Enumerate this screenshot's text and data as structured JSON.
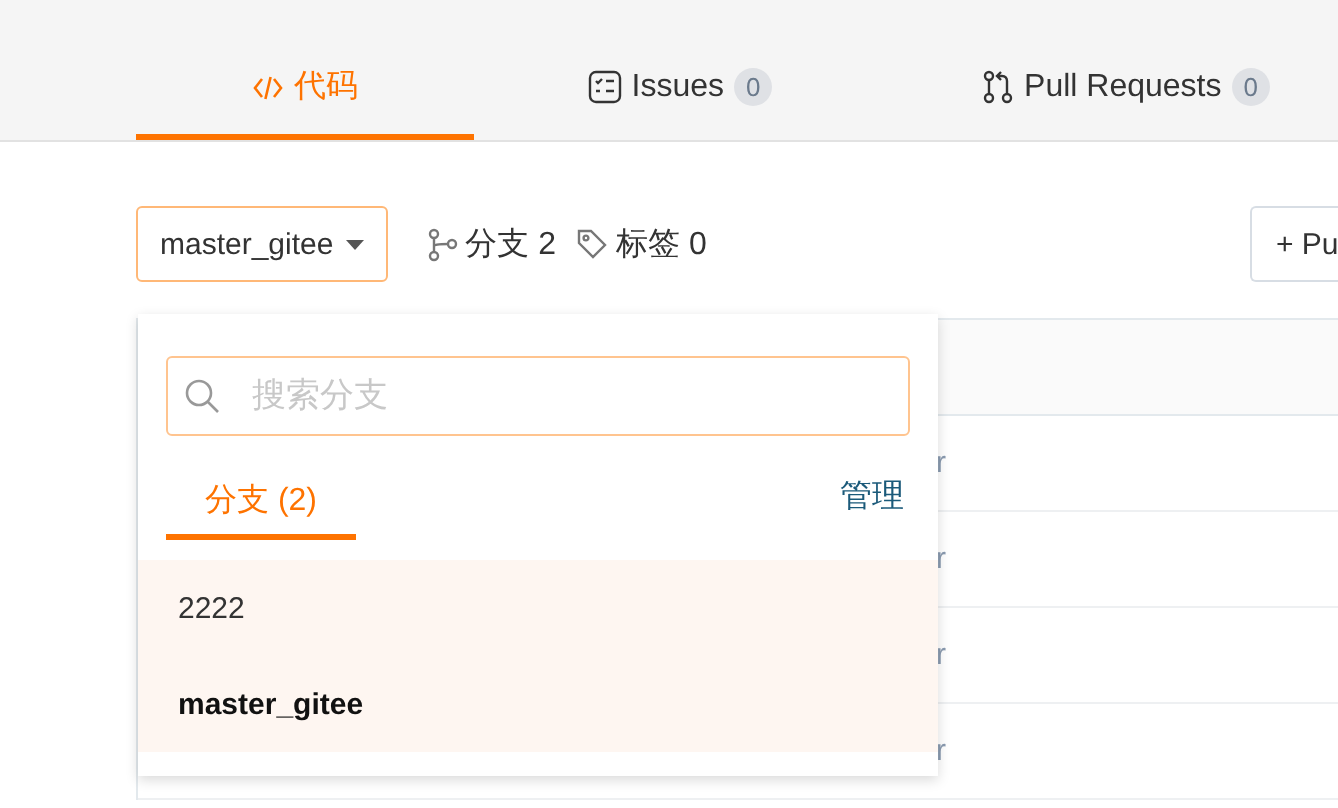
{
  "nav_tabs": [
    {
      "label": "代码",
      "kind": "code",
      "selected": true
    },
    {
      "label": "Issues",
      "kind": "issues",
      "count": "0",
      "selected": false
    },
    {
      "label": "Pull Requests",
      "kind": "pulls",
      "count": "0",
      "selected": false
    }
  ],
  "toolbar": {
    "branch_select": "master_gitee",
    "branches": "分支 2",
    "tags": "标签 0",
    "new_button": "+ Pu"
  },
  "table": {
    "rows": [
      {
        "column_2": "r"
      },
      {
        "column_2": "r"
      },
      {
        "column_2": "r"
      },
      {
        "column_2": "r"
      }
    ]
  },
  "branch_popup": {
    "search": {
      "placeholder": "搜索分支"
    },
    "tabs": [
      {
        "label": "分支 (2)",
        "selected": true
      }
    ],
    "manage_link": "管理",
    "branches": [
      {
        "name": "2222",
        "current": false
      },
      {
        "name": "master_gitee",
        "current": true
      }
    ]
  }
}
